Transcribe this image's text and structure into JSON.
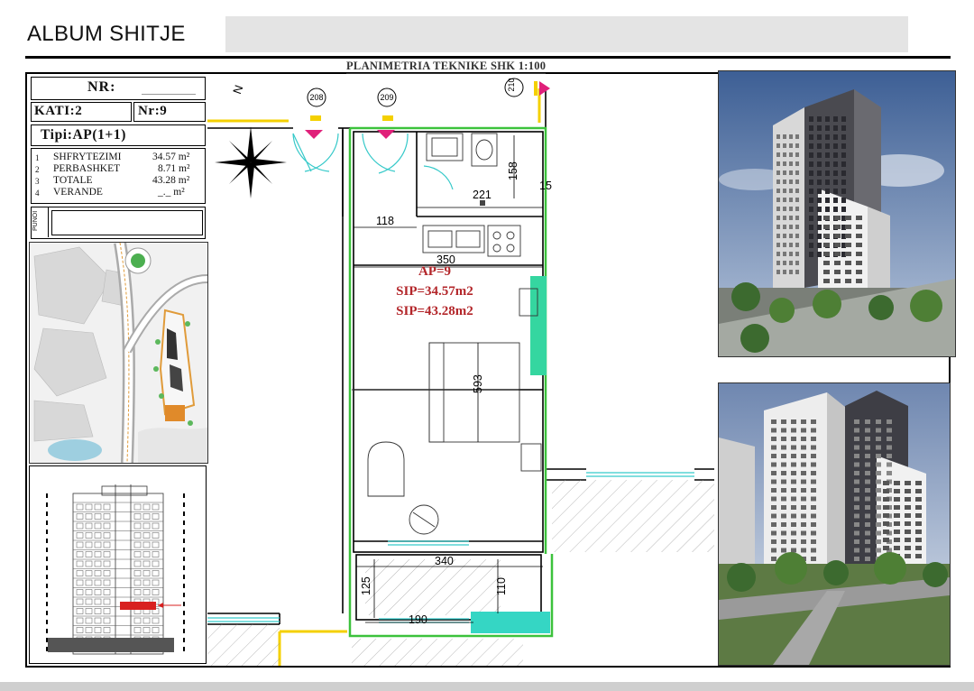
{
  "header": {
    "album_title": "ALBUM SHITJE",
    "plan_title": "PLANIMETRIA TEKNIKE SHK 1:100"
  },
  "info": {
    "nr_label": "NR:",
    "kati": "KATI:2",
    "nr": "Nr:9",
    "tipi": "Tipi:AP(1+1)",
    "rows": [
      {
        "idx": "1",
        "label": "SHFRYTEZIMI",
        "value": "34.57 m²"
      },
      {
        "idx": "2",
        "label": "PERBASHKET",
        "value": "8.71 m²"
      },
      {
        "idx": "3",
        "label": "TOTALE",
        "value": "43.28 m²"
      },
      {
        "idx": "4",
        "label": "VERANDE",
        "value": "_._ m²"
      }
    ],
    "punoi_label": "PUNOI"
  },
  "plan": {
    "north": "N",
    "grid_markers": [
      "208",
      "209",
      "210"
    ],
    "apartment": {
      "ap": "AP=9",
      "sip1": "SIP=34.57m2",
      "sip2": "SIP=43.28m2"
    },
    "dims": {
      "d158": "158",
      "d15": "15",
      "d221": "221",
      "d118": "118",
      "d350": "350",
      "d593": "593",
      "d340": "340",
      "d125": "125",
      "d110": "110",
      "d190": "190"
    },
    "colors": {
      "green": "#3cc23c",
      "cyan": "#35c9c9",
      "magenta": "#e0207a",
      "red_text": "#b3262a",
      "yellow": "#f4d000"
    }
  }
}
